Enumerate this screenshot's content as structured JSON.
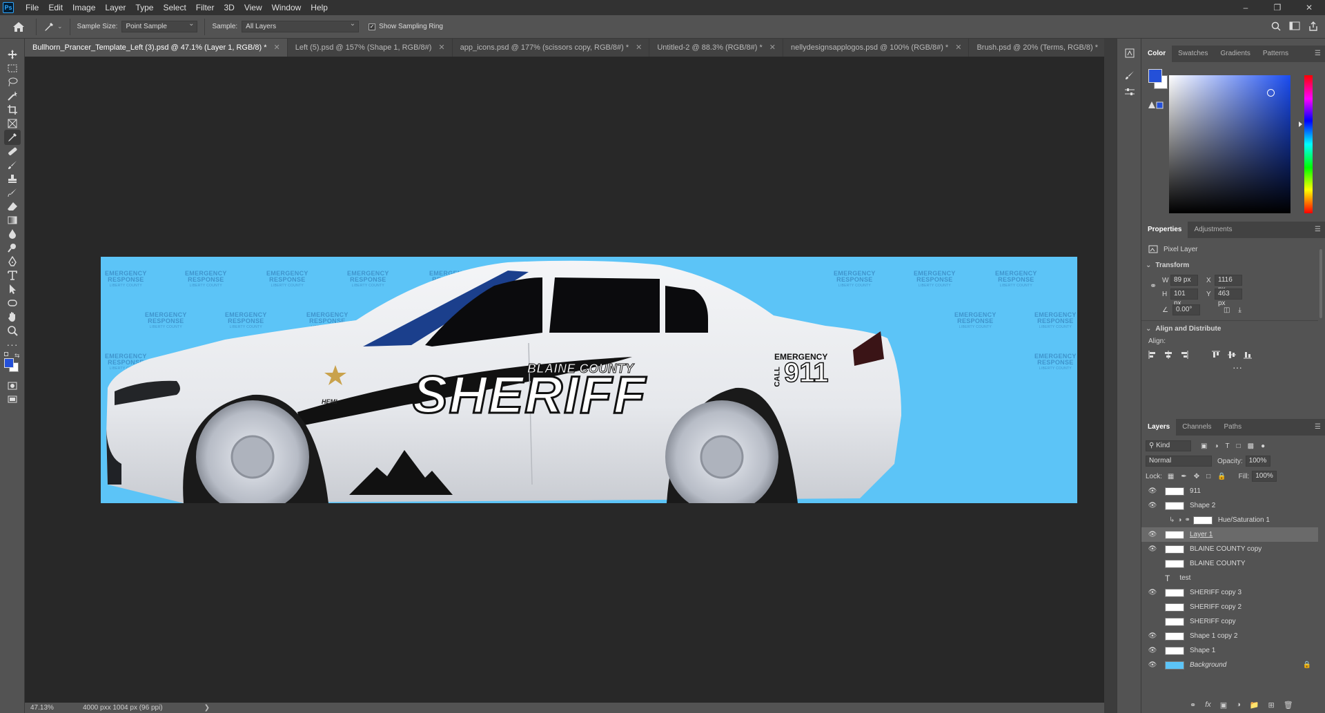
{
  "menu": [
    "File",
    "Edit",
    "Image",
    "Layer",
    "Type",
    "Select",
    "Filter",
    "3D",
    "View",
    "Window",
    "Help"
  ],
  "options": {
    "sample_size_label": "Sample Size:",
    "sample_size_value": "Point Sample",
    "sample_label": "Sample:",
    "sample_value": "All Layers",
    "show_sampling_ring": "Show Sampling Ring"
  },
  "tabs": [
    "Bullhorn_Prancer_Template_Left (3).psd @ 47.1% (Layer 1, RGB/8) *",
    "Left (5).psd @ 157% (Shape 1, RGB/8#)",
    "app_icons.psd @ 177% (scissors copy, RGB/8#) *",
    "Untitled-2 @ 88.3% (RGB/8#) *",
    "nellydesignsapplogos.psd @ 100% (RGB/8#) *",
    "Brush.psd @ 20% (Terms, RGB/8) *"
  ],
  "status": {
    "zoom": "47.13%",
    "doc_info": "4000 pxx 1004 px (96 ppi)"
  },
  "artwork": {
    "county": "BLAINE COUNTY",
    "title": "SHERIFF",
    "emergency": "EMERGENCY",
    "call": "CALL",
    "number": "911",
    "hemi": "HEMI",
    "watermark_top": "EMERGENCY",
    "watermark_mid": "RESPONSE",
    "watermark_small": "LIBERTY COUNTY"
  },
  "color_panel": {
    "tabs": [
      "Color",
      "Swatches",
      "Gradients",
      "Patterns"
    ],
    "foreground": "#2450d8",
    "background": "#ffffff"
  },
  "properties": {
    "tabs": [
      "Properties",
      "Adjustments"
    ],
    "layer_type": "Pixel Layer",
    "transform_label": "Transform",
    "w_label": "W",
    "w": "89 px",
    "h_label": "H",
    "h": "101 px",
    "x_label": "X",
    "x": "1116 px",
    "y_label": "Y",
    "y": "463 px",
    "angle": "0.00°",
    "align_label": "Align and Distribute",
    "align_sub": "Align:"
  },
  "layers": {
    "tabs": [
      "Layers",
      "Channels",
      "Paths"
    ],
    "kind": "Kind",
    "blend_mode": "Normal",
    "opacity_label": "Opacity:",
    "opacity": "100%",
    "lock_label": "Lock:",
    "fill_label": "Fill:",
    "fill": "100%",
    "items": [
      {
        "name": "911",
        "visible": true
      },
      {
        "name": "Shape 2",
        "visible": true
      },
      {
        "name": "Hue/Saturation 1",
        "visible": false
      },
      {
        "name": "Layer 1",
        "visible": true
      },
      {
        "name": "BLAINE COUNTY copy",
        "visible": true
      },
      {
        "name": "BLAINE COUNTY",
        "visible": false
      },
      {
        "name": "test",
        "visible": false
      },
      {
        "name": "SHERIFF copy 3",
        "visible": true
      },
      {
        "name": "SHERIFF copy 2",
        "visible": false
      },
      {
        "name": "SHERIFF copy",
        "visible": false
      },
      {
        "name": "Shape 1 copy 2",
        "visible": true
      },
      {
        "name": "Shape 1",
        "visible": true
      },
      {
        "name": "Background",
        "visible": true
      }
    ]
  }
}
